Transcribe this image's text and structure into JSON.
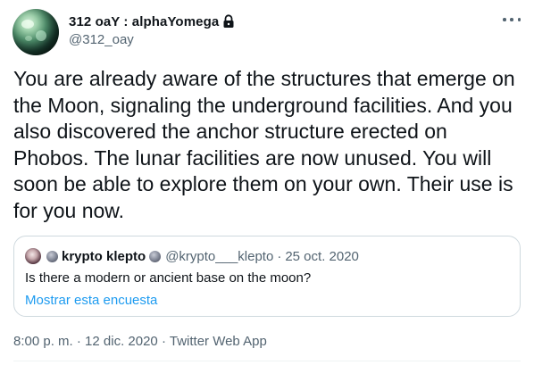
{
  "author": {
    "display_name": "312 oaY : alphaYomega",
    "handle": "@312_oay",
    "protected": true
  },
  "menu": {
    "more_icon": "more-horizontal-icon"
  },
  "tweet": {
    "text": "You are already aware of the structures that emerge on\nthe Moon, signaling the underground facilities. And you\nalso discovered the anchor structure erected on\nPhobos. The lunar facilities are now unused. You will\nsoon be able to explore them on your own. Their use is\nfor you now."
  },
  "quoted_tweet": {
    "display_name": "krypto klepto",
    "handle": "@krypto___klepto",
    "separator": "·",
    "date": "25 oct. 2020",
    "text": "Is there a modern or ancient base on the moon?",
    "poll_link": "Mostrar esta encuesta"
  },
  "footer": {
    "time": "8:00 p. m.",
    "separator1": "·",
    "date": "12 dic. 2020",
    "separator2": "·",
    "source": "Twitter Web App"
  },
  "colors": {
    "text_primary": "#0f1419",
    "text_secondary": "#536471",
    "link": "#1d9bf0",
    "border": "#cfd9de"
  }
}
